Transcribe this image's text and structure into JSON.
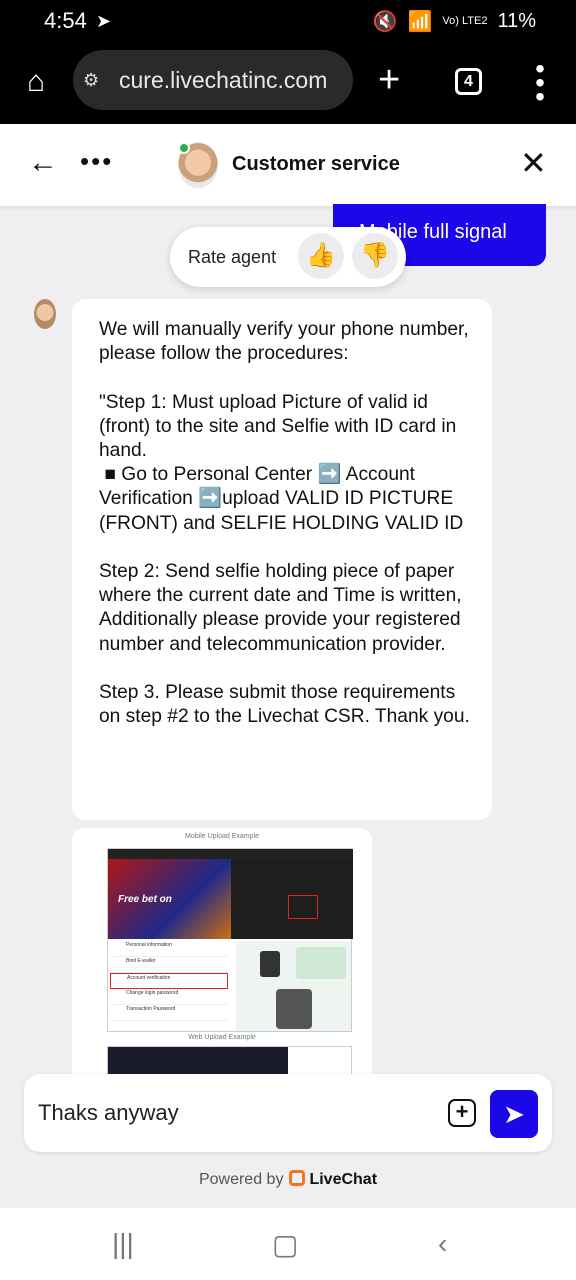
{
  "status": {
    "time": "4:54",
    "battery": "11%",
    "network": "Vo) LTE2"
  },
  "browser": {
    "url": "cure.livechatinc.com",
    "tab_count": "4"
  },
  "header": {
    "title": "Customer service"
  },
  "user_message": "Mobile full signal",
  "rate": {
    "label": "Rate agent"
  },
  "agent_message": "We will manually verify your phone number, please follow the procedures:\n\n\"Step 1: Must upload Picture of valid id (front) to the site and Selfie with ID card in hand.\n ■ Go to Personal Center ➡️ Account Verification ➡️upload VALID ID PICTURE (FRONT) and SELFIE HOLDING VALID ID\n\nStep 2: Send selfie holding piece of paper where the current date and Time is written, Additionally please provide your registered number and telecommunication provider.\n\nStep 3. Please submit those requirements on step #2 to the Livechat CSR. Thank you.",
  "image": {
    "caption_top": "Mobile Upload Example",
    "caption_bottom": "Web Upload Example",
    "promo_text": "Free bet on",
    "rows": [
      "Personal information",
      "Bind E-wallet",
      "Account verification",
      "Change login password",
      "Transaction Password"
    ]
  },
  "composer": {
    "text": "Thaks anyway"
  },
  "footer": {
    "powered_by": "Powered by",
    "brand": "LiveChat"
  }
}
